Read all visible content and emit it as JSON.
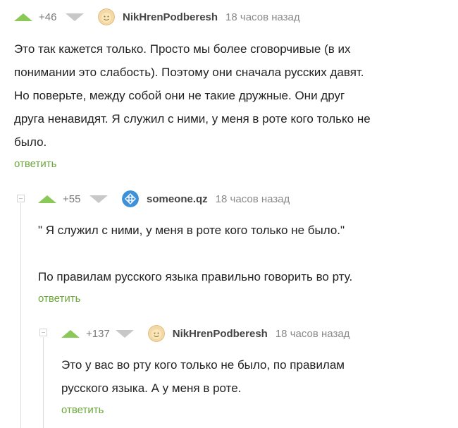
{
  "comments": [
    {
      "rating": "+46",
      "author": "NikHrenPodberesh",
      "time": "18 часов назад",
      "avatar_icon": "smiling-face-avatar-icon",
      "lines": [
        "Это так кажется только. Просто мы более сговорчивые (в их",
        "понимании это слабость). Поэтому они сначала русских давят.",
        "Но поверьте, между собой они не такие дружные. Они друг",
        "друга ненавидят. Я служил с ними, у меня в роте кого только не",
        "было."
      ],
      "reply_label": "ответить"
    },
    {
      "rating": "+55",
      "author": "someone.qz",
      "time": "18 часов назад",
      "avatar_icon": "blue-knot-avatar-icon",
      "lines": [
        "\"  Я служил с ними, у меня в роте кого только не было.\"",
        "",
        "По правилам русского языка правильно говорить во рту."
      ],
      "reply_label": "ответить"
    },
    {
      "rating": "+137",
      "author": "NikHrenPodberesh",
      "time": "18 часов назад",
      "avatar_icon": "smiling-face-avatar-icon",
      "lines": [
        "Это у вас во рту кого только не было, по правилам",
        "русского языка. А у меня в роте."
      ],
      "reply_label": "ответить"
    }
  ],
  "colors": {
    "upvote": "#8ac858",
    "downvote": "#c8c8c8",
    "reply_link": "#6aa83a",
    "thread_line": "#dcdcdc"
  }
}
